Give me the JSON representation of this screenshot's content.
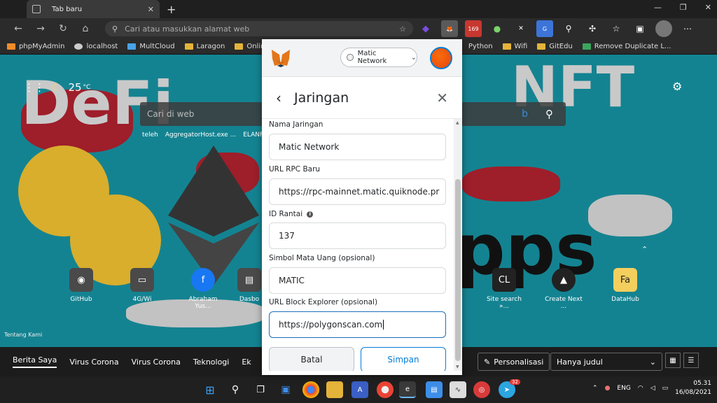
{
  "browser": {
    "tab_title": "Tab baru",
    "address_placeholder": "Cari atau masukkan alamat web",
    "ext_badge": "169",
    "bookmarks": [
      "phpMyAdmin",
      "localhost",
      "MultCloud",
      "Laragon",
      "Online Co",
      "Python",
      "Wifi",
      "GitEdu",
      "Remove Duplicate L..."
    ]
  },
  "newtab": {
    "temperature": "25",
    "temp_unit": "°C",
    "search_placeholder": "Cari di web",
    "recent": [
      "teleh",
      "AggregatorHost.exe ...",
      "ELANF"
    ],
    "tiles": [
      "GitHub",
      "4G/Wi",
      "Abraham Yus...",
      "Dasbo",
      "Site search »...",
      "Create Next ...",
      "DataHub"
    ],
    "about": "Tentang Kami",
    "news_tabs": [
      "Berita Saya",
      "Virus Corona",
      "Virus Corona",
      "Teknologi",
      "Ek"
    ],
    "personalize": "Personalisasi",
    "view_select": "Hanya judul"
  },
  "metamask": {
    "network_pill": "Matic Network",
    "page_title": "Jaringan",
    "fields": {
      "network_name_label": "Nama Jaringan",
      "network_name_value": "Matic Network",
      "rpc_label": "URL RPC Baru",
      "rpc_value": "https://rpc-mainnet.matic.quiknode.pr",
      "chain_label": "ID Rantai",
      "chain_value": "137",
      "symbol_label": "Simbol Mata Uang (opsional)",
      "symbol_value": "MATIC",
      "explorer_label": "URL Block Explorer (opsional)",
      "explorer_value": "https://polygonscan.com"
    },
    "cancel_label": "Batal",
    "save_label": "Simpan"
  },
  "taskbar": {
    "language": "ENG",
    "time": "05.31",
    "date": "16/08/2021",
    "badge": "32"
  },
  "colors": {
    "accent": "#037dd6",
    "bg": "#148391"
  }
}
